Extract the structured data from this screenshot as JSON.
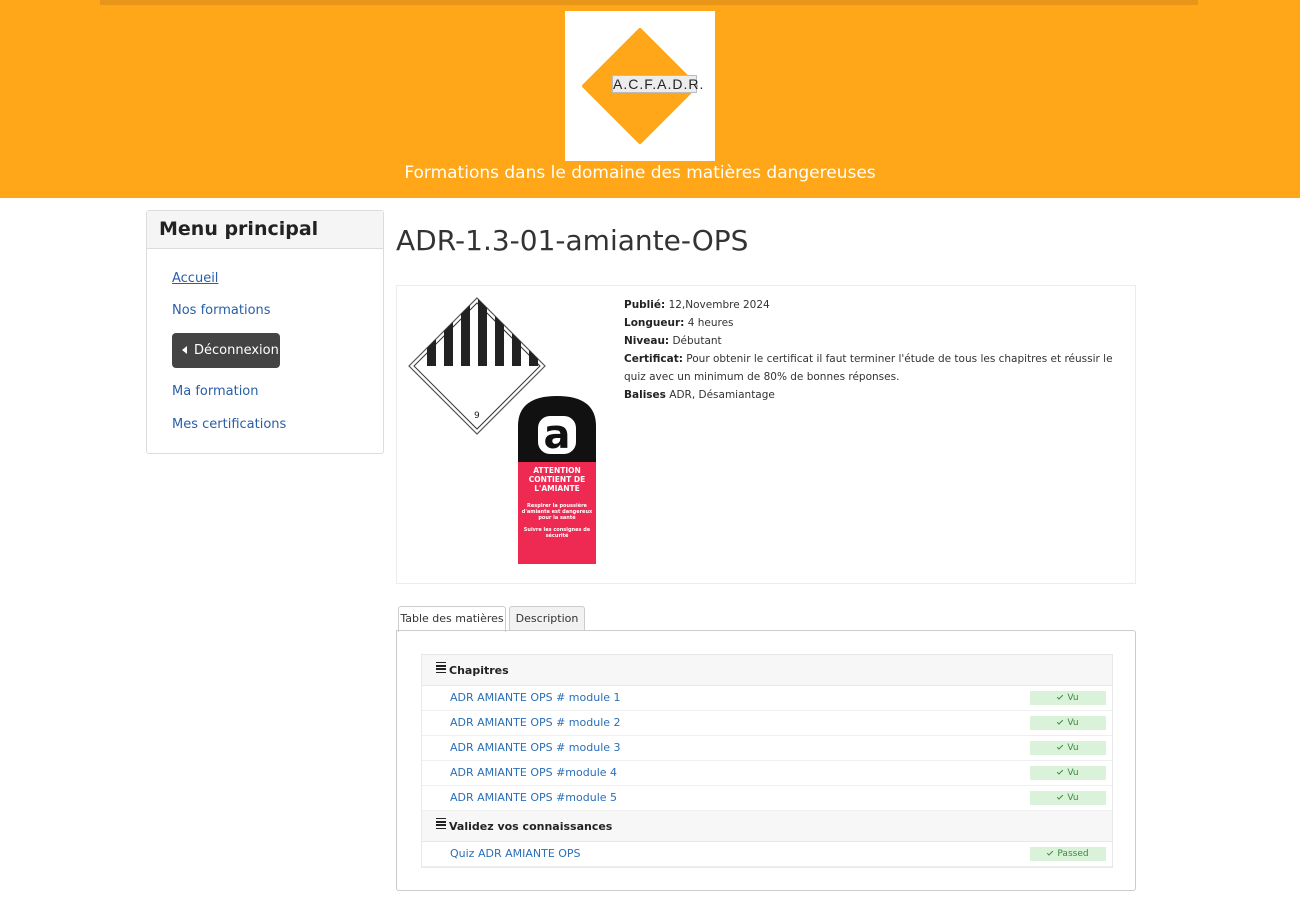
{
  "header": {
    "logo_text": "A.C.F.A.D.R.",
    "tagline": "Formations dans le domaine des matières dangereuses",
    "brand_color": "#ffa719"
  },
  "sidebar": {
    "title": "Menu principal",
    "items": [
      {
        "label": "Accueil"
      },
      {
        "label": "Nos formations"
      },
      {
        "label": "Déconnexion"
      },
      {
        "label": "Ma formation"
      },
      {
        "label": "Mes certifications"
      }
    ]
  },
  "main": {
    "title": "ADR-1.3-01-amiante-OPS",
    "info": {
      "published_label": "Publié:",
      "published_value": "12,Novembre 2024",
      "length_label": "Longueur:",
      "length_value": "4 heures",
      "level_label": "Niveau:",
      "level_value": "Débutant",
      "certificate_label": "Certificat:",
      "certificate_value": "Pour obtenir le certificat il faut terminer l'étude de tous les chapitres et réussir le quiz avec un minimum de 80% de bonnes réponses.",
      "tags_label": "Balises",
      "tags_value": "ADR, Désamiantage"
    },
    "images": {
      "diamond_number": "9",
      "asbestos_letter": "a",
      "asbestos_title": "ATTENTION CONTIENT DE L'AMIANTE",
      "asbestos_text1": "Respirer la poussière d'amiante est dangereux pour la santé",
      "asbestos_text2": "Suivre les consignes de sécurité"
    },
    "tabs": [
      {
        "label": "Table des matières",
        "active": true
      },
      {
        "label": "Description",
        "active": false
      }
    ],
    "toc": {
      "section1": "Chapitres",
      "chapters": [
        {
          "title": "ADR AMIANTE OPS # module 1",
          "status": "Vu"
        },
        {
          "title": "ADR AMIANTE OPS # module 2",
          "status": "Vu"
        },
        {
          "title": "ADR AMIANTE OPS # module 3",
          "status": "Vu"
        },
        {
          "title": "ADR AMIANTE OPS #module 4",
          "status": "Vu"
        },
        {
          "title": "ADR AMIANTE OPS #module 5",
          "status": "Vu"
        }
      ],
      "section2": "Validez vos connaissances",
      "quiz": {
        "title": "Quiz ADR AMIANTE OPS",
        "status": "Passed"
      }
    }
  }
}
